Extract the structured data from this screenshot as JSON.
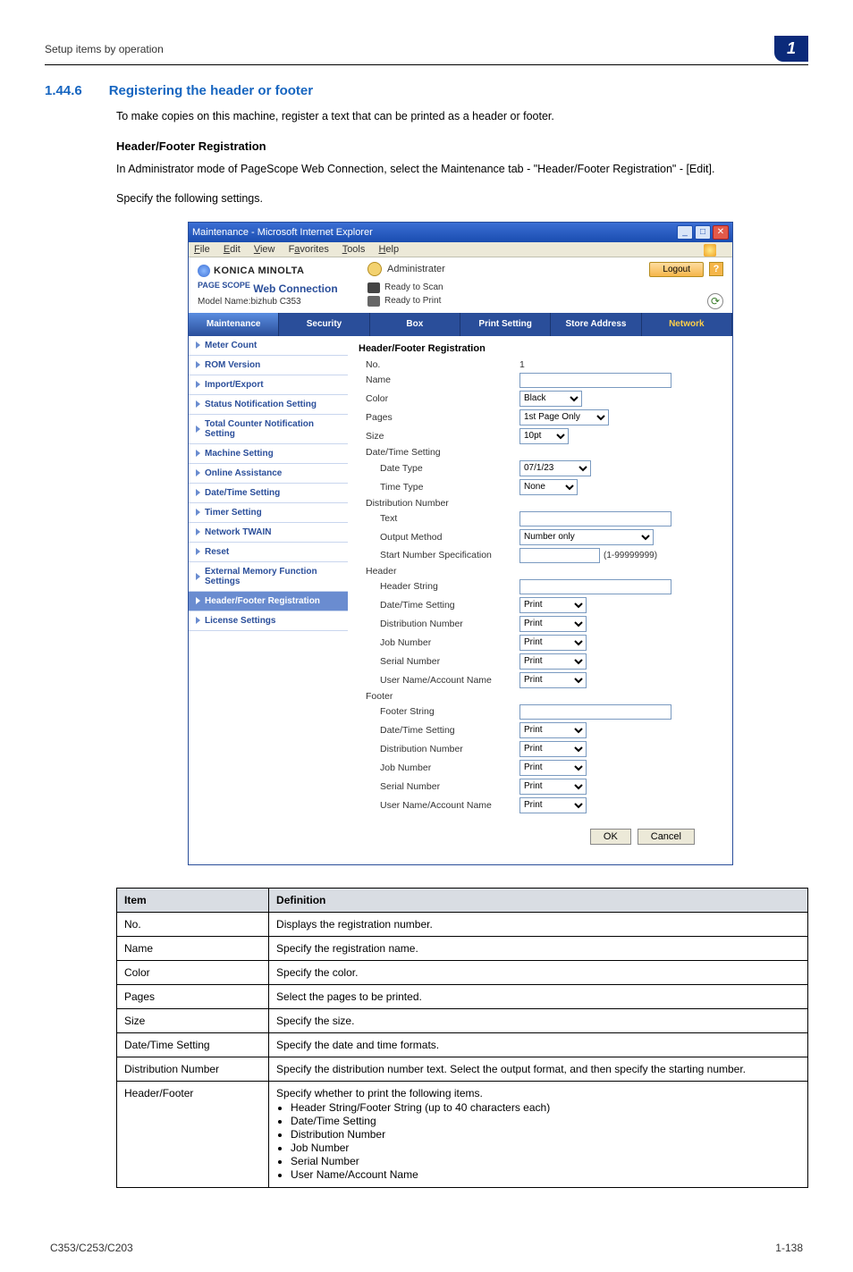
{
  "breadcrumb": "Setup items by operation",
  "chapter_badge": "1",
  "section": {
    "num": "1.44.6",
    "title": "Registering the header or footer"
  },
  "intro_text": "To make copies on this machine, register a text that can be printed as a header or footer.",
  "sub_title": "Header/Footer Registration",
  "admin_text1": "In Administrator mode of PageScope Web Connection, select the Maintenance tab - \"Header/Footer Registration\" - [Edit].",
  "admin_text2": "Specify the following settings.",
  "ie": {
    "title": "Maintenance - Microsoft Internet Explorer",
    "menu": {
      "file": "File",
      "edit": "Edit",
      "view": "View",
      "favorites": "Favorites",
      "tools": "Tools",
      "help": "Help"
    }
  },
  "km": {
    "brand": "KONICA MINOLTA",
    "pagescope": "Web Connection",
    "ps_prefix": "PAGE SCOPE",
    "model": "Model Name:bizhub C353",
    "admin_label": "Administrater",
    "logout": "Logout",
    "status_scan": "Ready to Scan",
    "status_print": "Ready to Print",
    "tabs": {
      "maintenance": "Maintenance",
      "security": "Security",
      "box": "Box",
      "print": "Print Setting",
      "store": "Store Address",
      "network": "Network"
    },
    "nav": [
      "Meter Count",
      "ROM Version",
      "Import/Export",
      "Status Notification Setting",
      "Total Counter Notification Setting",
      "Machine Setting",
      "Online Assistance",
      "Date/Time Setting",
      "Timer Setting",
      "Network TWAIN",
      "Reset",
      "External Memory Function Settings",
      "Header/Footer Registration",
      "License Settings"
    ],
    "form": {
      "title": "Header/Footer Registration",
      "no_label": "No.",
      "no_value": "1",
      "name_label": "Name",
      "name_value": "",
      "color_label": "Color",
      "color_value": "Black",
      "pages_label": "Pages",
      "pages_value": "1st Page Only",
      "size_label": "Size",
      "size_value": "10pt",
      "dt_label": "Date/Time Setting",
      "date_type_label": "Date Type",
      "date_type_value": "07/1/23",
      "time_type_label": "Time Type",
      "time_type_value": "None",
      "dist_label": "Distribution Number",
      "text_label": "Text",
      "text_value": "",
      "output_label": "Output Method",
      "output_value": "Number only",
      "start_label": "Start Number Specification",
      "start_value": "",
      "start_hint": "(1-99999999)",
      "header_label": "Header",
      "header_string_label": "Header String",
      "header_string_value": "",
      "h_dt_label": "Date/Time Setting",
      "h_dt_value": "Print",
      "h_dist_label": "Distribution Number",
      "h_dist_value": "Print",
      "h_job_label": "Job Number",
      "h_job_value": "Print",
      "h_serial_label": "Serial Number",
      "h_serial_value": "Print",
      "h_user_label": "User Name/Account Name",
      "h_user_value": "Print",
      "footer_label": "Footer",
      "footer_string_label": "Footer String",
      "footer_string_value": "",
      "f_dt_label": "Date/Time Setting",
      "f_dt_value": "Print",
      "f_dist_label": "Distribution Number",
      "f_dist_value": "Print",
      "f_job_label": "Job Number",
      "f_job_value": "Print",
      "f_serial_label": "Serial Number",
      "f_serial_value": "Print",
      "f_user_label": "User Name/Account Name",
      "f_user_value": "Print",
      "ok": "OK",
      "cancel": "Cancel"
    }
  },
  "table": {
    "head_item": "Item",
    "head_def": "Definition",
    "rows": [
      {
        "item": "No.",
        "def": "Displays the registration number."
      },
      {
        "item": "Name",
        "def": "Specify the registration name."
      },
      {
        "item": "Color",
        "def": "Specify the color."
      },
      {
        "item": "Pages",
        "def": "Select the pages to be printed."
      },
      {
        "item": "Size",
        "def": "Specify the size."
      },
      {
        "item": "Date/Time Setting",
        "def": "Specify the date and time formats."
      },
      {
        "item": "Distribution Number",
        "def": "Specify the distribution number text. Select the output format, and then specify the starting number."
      }
    ],
    "hf_item": "Header/Footer",
    "hf_intro": "Specify whether to print the following items.",
    "hf_bullets": [
      "Header String/Footer String (up to 40 characters each)",
      "Date/Time Setting",
      "Distribution Number",
      "Job Number",
      "Serial Number",
      "User Name/Account Name"
    ]
  },
  "footer": {
    "left": "C353/C253/C203",
    "right": "1-138"
  }
}
